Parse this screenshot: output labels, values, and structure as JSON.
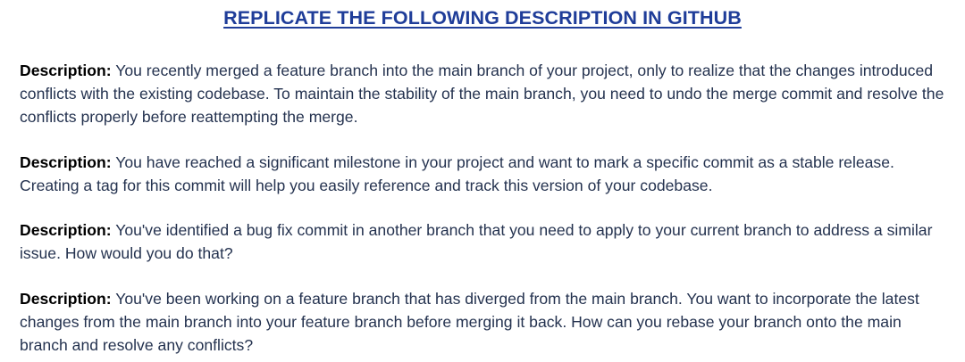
{
  "title": "REPLICATE THE FOLLOWING DESCRIPTION IN GITHUB",
  "items": [
    {
      "label": "Description:",
      "text": "You recently merged a feature branch into the main branch of your project, only to realize that the changes introduced conflicts with the existing codebase. To maintain the stability of the main branch, you need to undo the merge commit and resolve the conflicts properly before reattempting the merge."
    },
    {
      "label": "Description:",
      "text": "You have reached a significant milestone in your project and want to mark a specific commit as a stable release. Creating a tag for this commit will help you easily reference and track this version of your codebase."
    },
    {
      "label": "Description:",
      "text": "You've identified a bug fix commit in another branch that you need to apply to your current branch to address a similar issue. How would you do that?"
    },
    {
      "label": "Description:",
      "text": "You've been working on a feature branch that has diverged from the main branch. You want to incorporate the latest changes from the main branch into your feature branch before merging it back. How can you rebase your branch onto the main branch and resolve any conflicts?"
    }
  ]
}
